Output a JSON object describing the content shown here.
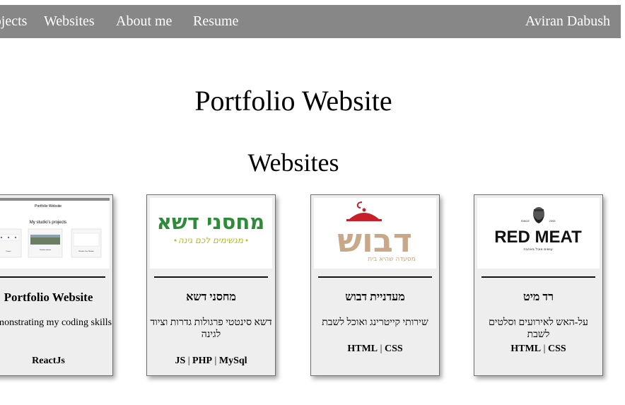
{
  "nav": {
    "items": [
      "Projects",
      "Websites",
      "About me",
      "Resume"
    ],
    "brand": "Aviran Dabush"
  },
  "page": {
    "title": "Portfolio Website",
    "section": "Websites"
  },
  "cards": [
    {
      "title": "Portfolio Website",
      "description": "Demonstrating my coding skills",
      "tech": [
        "ReactJs"
      ],
      "thumb": {
        "header": "Portfolio Website",
        "subheader": "My studio's projects",
        "panel_labels": [
          "Project",
          "Portfolio website",
          "Weather Tour Window"
        ]
      }
    },
    {
      "title": "מחסני דשא",
      "description": "דשא סינטטי פרגולות גדרות וציוד לגינה",
      "tech": [
        "JS",
        "PHP",
        "MySql"
      ],
      "logo": {
        "main": "מחסני דשא",
        "tagline": "מגשימים לכם גינה"
      }
    },
    {
      "title": "מעדניית דבוש",
      "description": "שירותי קייטרינג ואוכל לשבת",
      "tech": [
        "HTML",
        "CSS"
      ],
      "logo": {
        "main": "דבוש",
        "tagline": "מסעדה שהיא בית"
      }
    },
    {
      "title": "רד מיט",
      "description": "על-האש לאירועים וסלטים לשבת",
      "tech": [
        "HTML",
        "CSS"
      ],
      "logo": {
        "since": "SINCE",
        "year": "2005",
        "main": "RED MEAT",
        "tagline": "עושים אוכל באהבה"
      }
    }
  ],
  "colors": {
    "navbar": "#878787",
    "card_bg": "#eeeeee",
    "green": "#2e8b3a",
    "lime": "#c6c933",
    "tan": "#c9a88a",
    "red": "#c8202a"
  }
}
